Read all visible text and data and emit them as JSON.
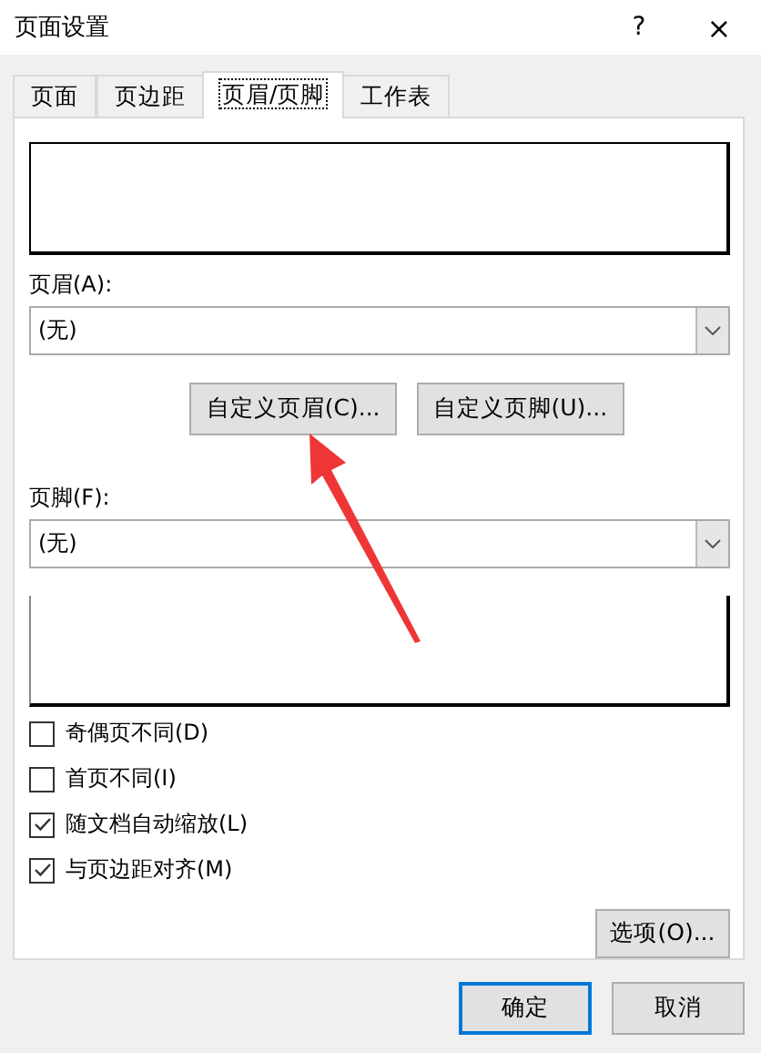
{
  "window": {
    "title": "页面设置",
    "help": "?",
    "close": "×"
  },
  "tabs": [
    {
      "label": "页面",
      "selected": false
    },
    {
      "label": "页边距",
      "selected": false
    },
    {
      "label": "页眉/页脚",
      "selected": true
    },
    {
      "label": "工作表",
      "selected": false
    }
  ],
  "header": {
    "label": "页眉(A):",
    "value": "(无)"
  },
  "custom_buttons": [
    "自定义页眉(C)...",
    "自定义页脚(U)..."
  ],
  "footer": {
    "label": "页脚(F):",
    "value": "(无)"
  },
  "options": [
    {
      "label": "奇偶页不同(D)",
      "checked": false
    },
    {
      "label": "首页不同(I)",
      "checked": false
    },
    {
      "label": "随文档自动缩放(L)",
      "checked": true
    },
    {
      "label": "与页边距对齐(M)",
      "checked": true
    }
  ],
  "options_button": "选项(O)...",
  "buttons": [
    {
      "label": "确定",
      "default": true
    },
    {
      "label": "取消",
      "default": false
    }
  ]
}
